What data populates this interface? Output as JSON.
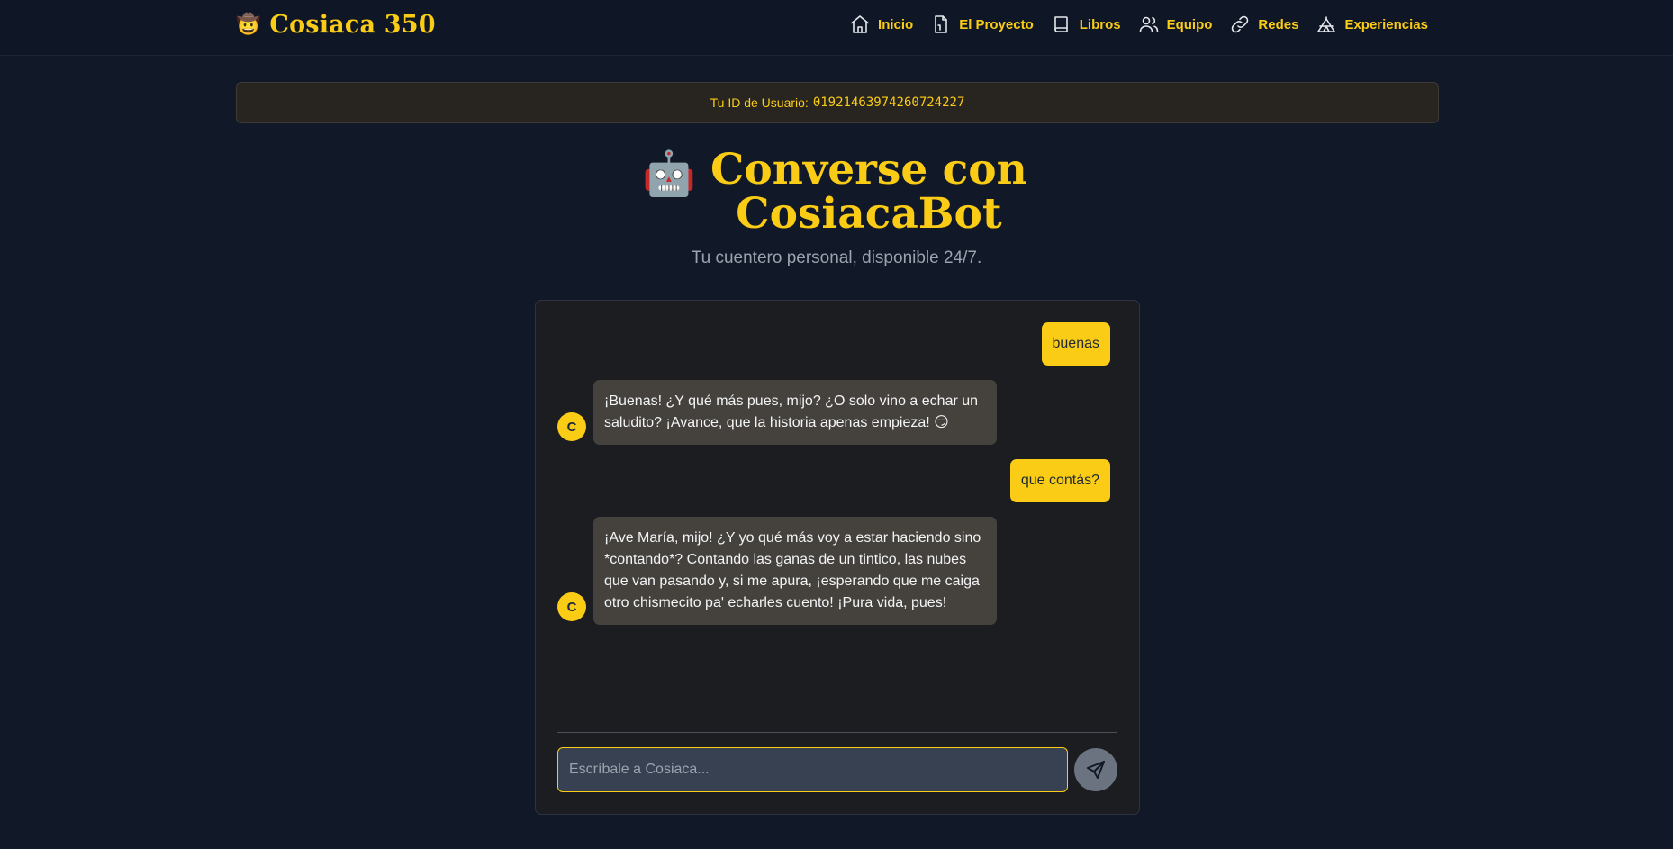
{
  "nav": {
    "brand_emoji": "🤠",
    "brand_name": "Cosiaca 350",
    "links": [
      {
        "label": "Inicio",
        "icon": "home-icon"
      },
      {
        "label": "El Proyecto",
        "icon": "document-icon"
      },
      {
        "label": "Libros",
        "icon": "book-icon"
      },
      {
        "label": "Equipo",
        "icon": "users-icon"
      },
      {
        "label": "Redes",
        "icon": "link-icon"
      },
      {
        "label": "Experiencias",
        "icon": "tent-icon"
      }
    ]
  },
  "user_bar": {
    "label": "Tu ID de Usuario:",
    "user_id": "01921463974260724227"
  },
  "header": {
    "emoji": "🤖",
    "title": "Converse con CosiacaBot",
    "subtitle": "Tu cuentero personal, disponible 24/7."
  },
  "chat": {
    "messages": [
      {
        "role": "user",
        "text": "buenas"
      },
      {
        "role": "bot",
        "avatar": "C",
        "text": "¡Buenas! ¿Y qué más pues, mijo? ¿O solo vino a echar un saludito? ¡Avance, que la historia apenas empieza! 😏"
      },
      {
        "role": "user",
        "text": "que contás?"
      },
      {
        "role": "bot",
        "avatar": "C",
        "text": "¡Ave María, mijo! ¿Y yo qué más voy a estar haciendo sino *contando*? Contando las ganas de un tintico, las nubes que van pasando y, si me apura, ¡esperando que me caiga otro chismecito pa' echarles cuento! ¡Pura vida, pues!"
      }
    ],
    "input_placeholder": "Escríbale a Cosiaca...",
    "input_value": "",
    "send_icon": "send-icon"
  },
  "colors": {
    "background": "#111827",
    "accent": "#facc15",
    "bot_bubble": "#45423e",
    "panel": "#1c1d21"
  }
}
